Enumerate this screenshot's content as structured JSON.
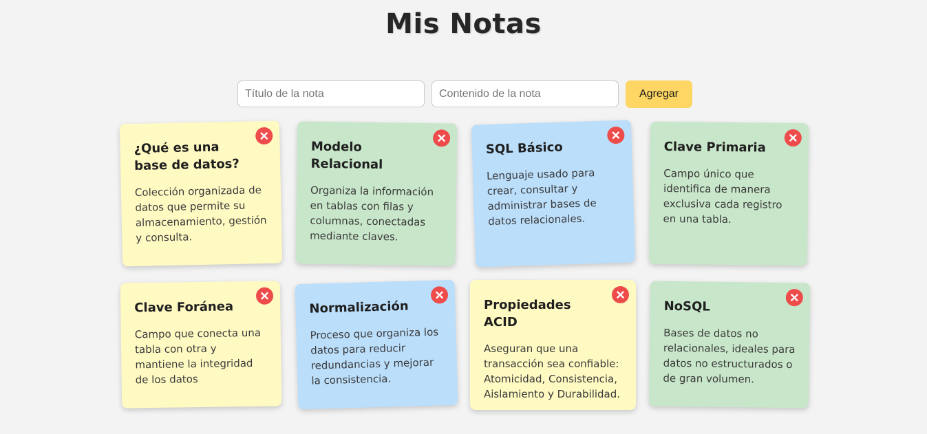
{
  "header": {
    "title": "Mis Notas"
  },
  "form": {
    "title_placeholder": "Título de la nota",
    "content_placeholder": "Contenido de la nota",
    "add_label": "Agregar"
  },
  "notes": [
    {
      "title": "¿Qué es una base de datos?",
      "content": "Colección organizada de datos que permite su almacenamiento, gestión y consulta.",
      "color": "#fff9c2"
    },
    {
      "title": "Modelo Relacional",
      "content": "Organiza la información en tablas con filas y columnas, conectadas mediante claves.",
      "color": "#c8e6c9"
    },
    {
      "title": "SQL Básico",
      "content": "Lenguaje usado para crear, consultar y administrar bases de datos relacionales.",
      "color": "#bbdefb"
    },
    {
      "title": "Clave Primaria",
      "content": "Campo único que identifica de manera exclusiva cada registro en una tabla.",
      "color": "#c8e6c9"
    },
    {
      "title": "Clave Foránea",
      "content": "Campo que conecta una tabla con otra y mantiene la integridad de los datos",
      "color": "#fff9c2"
    },
    {
      "title": "Normalización",
      "content": "Proceso que organiza los datos para reducir redundancias y mejorar la consistencia.",
      "color": "#bbdefb"
    },
    {
      "title": "Propiedades ACID",
      "content": "Aseguran que una transacción sea confiable: Atomicidad, Consistencia, Aislamiento y Durabilidad.",
      "color": "#fff9c2"
    },
    {
      "title": "NoSQL",
      "content": "Bases de datos no relacionales, ideales para datos no estructurados o de gran volumen.",
      "color": "#c8e6c9"
    }
  ],
  "icons": {
    "delete": "close-circle-icon"
  },
  "colors": {
    "accent": "#fdd663",
    "delete": "#ee4b4b",
    "background": "#f3f3f3"
  }
}
